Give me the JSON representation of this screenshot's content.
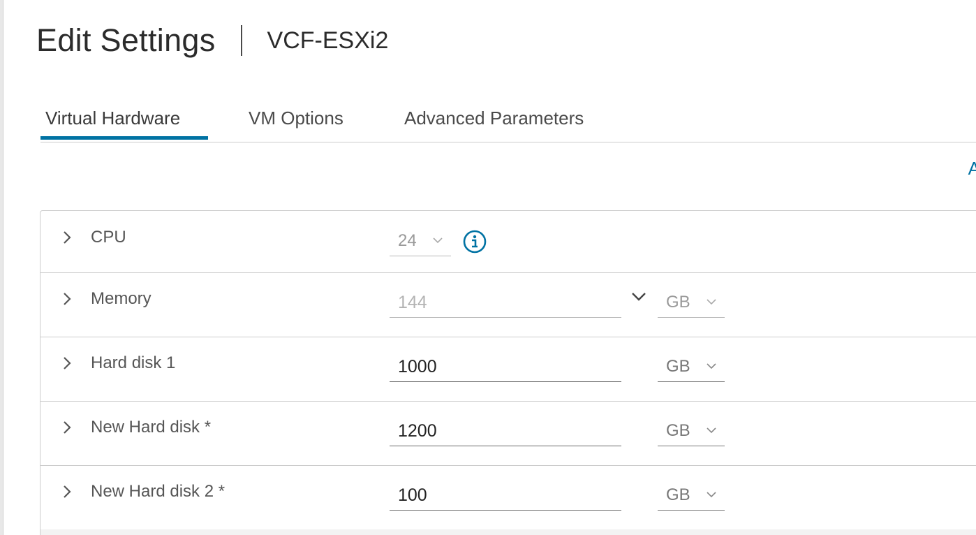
{
  "header": {
    "title": "Edit Settings",
    "vm_name": "VCF-ESXi2"
  },
  "tabs": [
    {
      "label": "Virtual Hardware",
      "active": true
    },
    {
      "label": "VM Options",
      "active": false
    },
    {
      "label": "Advanced Parameters",
      "active": false
    }
  ],
  "add_device_link": "A",
  "hardware": {
    "cpu": {
      "label": "CPU",
      "value": "24"
    },
    "memory": {
      "label": "Memory",
      "value": "144",
      "unit": "GB"
    },
    "hard_disk_1": {
      "label": "Hard disk 1",
      "value": "1000",
      "unit": "GB"
    },
    "new_hard_disk": {
      "label": "New Hard disk *",
      "value": "1200",
      "unit": "GB"
    },
    "new_hard_disk_2": {
      "label": "New Hard disk 2 *",
      "value": "100",
      "unit": "GB"
    }
  },
  "colors": {
    "accent": "#0072a3",
    "border": "#cccccc",
    "text": "#333333"
  },
  "icons": {
    "expand": "chevron-right-icon",
    "info": "info-icon",
    "dropdown": "chevron-down-icon"
  }
}
